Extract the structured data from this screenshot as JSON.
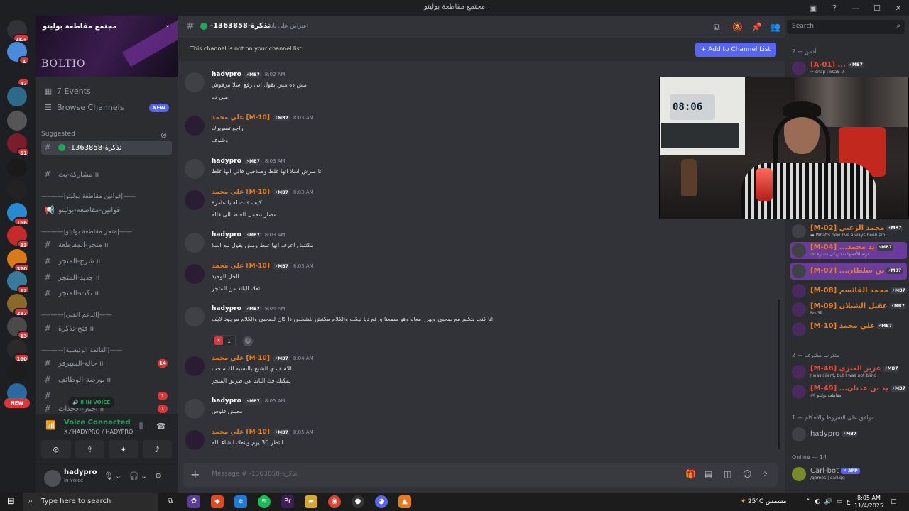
{
  "window": {
    "title": "مجتمع مقاطعة بوليتو"
  },
  "servers": [
    {
      "badge": "1K+"
    },
    {
      "badge": "1"
    },
    {
      "badge": "47"
    },
    {
      "badge": ""
    },
    {
      "badge": ""
    },
    {
      "badge": "51"
    },
    {
      "badge": ""
    },
    {
      "badge": ""
    },
    {
      "badge": "166"
    },
    {
      "badge": "33"
    },
    {
      "badge": "370"
    },
    {
      "badge": "12"
    },
    {
      "badge": "287"
    },
    {
      "badge": "13"
    },
    {
      "badge": "160"
    },
    {
      "badge": ""
    },
    {
      "badge": ""
    }
  ],
  "rail_new": "NEW",
  "sidebar": {
    "server_name": "مجتمع مقاطعة بوليتو",
    "banner_text": "BOLTIO",
    "events": "7 Events",
    "browse": "Browse Channels",
    "browse_badge": "NEW",
    "suggested": "Suggested",
    "channels": [
      {
        "name": "-1363858-تذكرة",
        "cnt": ""
      },
      {
        "name": "مشاركة-بث ıı",
        "cnt": ""
      }
    ],
    "cat1": "—–——|قوانين مقاطعة بوليتو|——",
    "ch_rules": "قوانين-مقاطعة-بوليتو",
    "cat2": "—–——|متجر مقاطعة بوليتو|——",
    "store_channels": [
      "متجر-المقاطعة ıı",
      "شرح-المتجر ıı",
      "جديد-المتجر ıı",
      "تكت-المتجر ıı"
    ],
    "cat3": "—–——|الدعم الفني|——",
    "ch_ticket": "فتح-تذكرة ıı",
    "cat4": "—–——|القائمة الرئيسية|——",
    "main_channels": [
      {
        "name": "حالة-السيرفر ıı",
        "cnt": "14"
      },
      {
        "name": "بورصة-الوظائف ıı",
        "cnt": ""
      },
      {
        "name": "",
        "cnt": "1"
      },
      {
        "name": "اخبار-الاحداث ıı",
        "cnt": "1"
      }
    ],
    "in_voice": "8 IN VOICE"
  },
  "voice": {
    "title": "Voice Connected",
    "sub": "X ⁄ HADYPRO / HADYPRO"
  },
  "user": {
    "name": "hadypro",
    "status": "In voice"
  },
  "channel": {
    "name": "-1363858-تذكرة",
    "topic": "اعتراض على باند",
    "notice": "This channel is not on your channel list.",
    "add_button": "+ Add to Channel List",
    "composer_placeholder": "Message # -1363858-تذكرة"
  },
  "messages": [
    {
      "user": "hadypro",
      "tag": "⚡MB7",
      "time": "8:02 AM",
      "lines": [
        "مش ده مش بقول انى رفع اسلا مرفوش",
        "مين ده"
      ]
    },
    {
      "user": "علي محمد [M-10]",
      "tag": "⚡MB7",
      "time": "8:03 AM",
      "lines": [
        "راجع تسويرك",
        "وشوف"
      ]
    },
    {
      "user": "hadypro",
      "tag": "⚡MB7",
      "time": "8:03 AM",
      "lines": [
        "انا مبرش اسلا انها غلط وصلاحيي قالي انها غلط"
      ]
    },
    {
      "user": "علي محمد [M-10]",
      "tag": "⚡MB7",
      "time": "8:03 AM",
      "lines": [
        "كيف قلت له يا عامرة",
        "مضار تتحمل الغلط الى قاله"
      ]
    },
    {
      "user": "hadypro",
      "tag": "⚡MB7",
      "time": "8:03 AM",
      "lines": [
        "مكنتش اعرف انها غلط ومش بقول ليه اسلا"
      ]
    },
    {
      "user": "علي محمد [M-10]",
      "tag": "⚡MB7",
      "time": "8:03 AM",
      "lines": [
        "الحل الوحيد",
        "تفك الباند من المتجر"
      ]
    },
    {
      "user": "hadypro",
      "tag": "⚡MB7",
      "time": "8:04 AM",
      "lines": [
        "انا كنت بتكلم مع صحبي ويهزر معاه وهو سمعنا ورفع ديا تيكت والكلام مكنش للشخص دا كان لصحبي والكلام موجود لايف"
      ],
      "reaction": "1"
    },
    {
      "user": "علي محمد [M-10]",
      "tag": "⚡MB7",
      "time": "8:04 AM",
      "lines": [
        "للاسف ي الشيخ بالنسبة لك سحب",
        "يمكنك فك الباند عن طريق المتجر"
      ]
    },
    {
      "user": "hadypro",
      "tag": "⚡MB7",
      "time": "8:05 AM",
      "lines": [
        "معيش فلوس"
      ]
    },
    {
      "user": "علي محمد [M-10]",
      "tag": "⚡MB7",
      "time": "8:05 AM",
      "lines": [
        "انتظر 30 يوم وينفك انشاء الله"
      ]
    }
  ],
  "search": {
    "placeholder": "Search"
  },
  "members": {
    "group_admin": "أدمن — 2",
    "group_trainee": "متدرب مشرف — 2",
    "group_rules": "موافق على الشروط والأحكام — 1",
    "group_online": "Online — 14",
    "list": [
      {
        "name": "[A-01] ...",
        "status": "✈ snap : ksa5-2",
        "tag": "⚡MB7"
      },
      {
        "name": "[M-02] محمد الزعبي",
        "status": "▬ What's new I've always been alo...",
        "tag": "⚡MB7"
      },
      {
        "name": "[M-04] ...يد محمد",
        "status": "🎮 فرنة الأخطها نقلا زبكى مثدارة",
        "tag": "⚡MB7"
      },
      {
        "name": "[M-07] ...بن سلطان",
        "status": "",
        "tag": "⚡MB7"
      },
      {
        "name": "[M-08] محمد القائسم",
        "status": "",
        "tag": "⚡MB7"
      },
      {
        "name": "[M-09] عقيل الشبلان",
        "status": "Bo 3li",
        "tag": "⚡MB7"
      },
      {
        "name": "[M-10] علي محمد",
        "status": "",
        "tag": "⚡MB7"
      },
      {
        "name": "[M-48] عزيز العنزي",
        "status": "I was silent, but I was not blind",
        "tag": "⚡MB7"
      },
      {
        "name": "[M-49] ...يد بن عدنان",
        "status": "🎮 مقاطعة بوليتو",
        "tag": "⚡MB7"
      },
      {
        "name": "hadypro",
        "status": "",
        "tag": "⚡MB7"
      },
      {
        "name": "Carl-bot",
        "status": "/games | carl.gg",
        "tag": "✔ APP"
      }
    ]
  },
  "cam_clock": "08:06",
  "taskbar": {
    "search": "Type here to search",
    "weather": "25°C مشمس",
    "time": "8:05 AM",
    "date": "11/4/2025",
    "lang": "ع"
  },
  "colors": {
    "accent": "#5865f2",
    "online": "#23a55a",
    "alert": "#da373c",
    "role": "#e67e22"
  }
}
